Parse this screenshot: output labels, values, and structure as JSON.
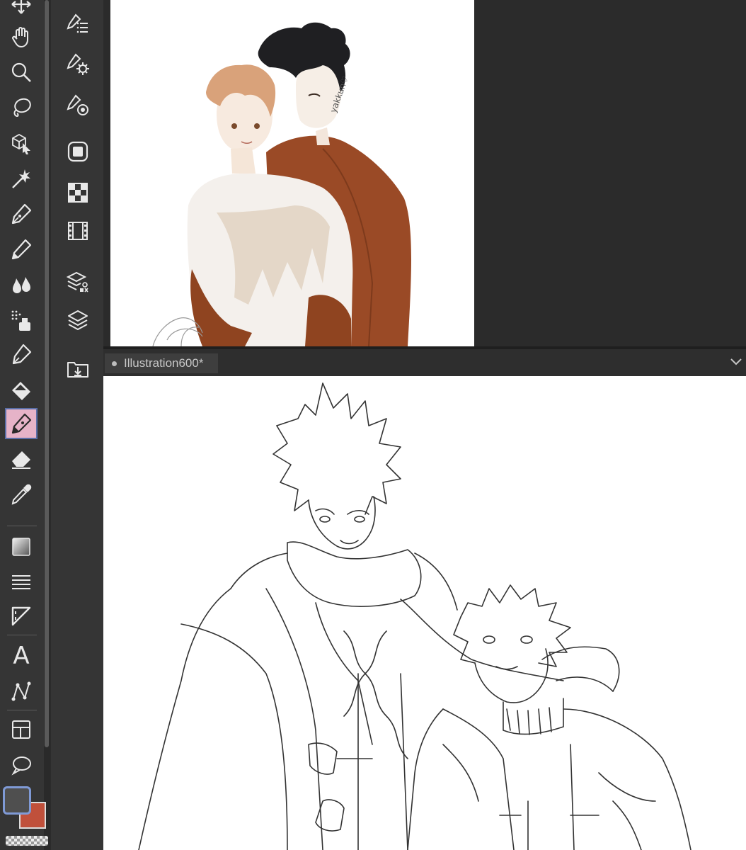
{
  "document": {
    "tab_title": "Illustration600*",
    "modified": true
  },
  "reference": {
    "signature": "yakkun♡"
  },
  "toolbar": {
    "tools": [
      {
        "name": "move",
        "icon": "move-arrows-icon"
      },
      {
        "name": "hand",
        "icon": "hand-icon"
      },
      {
        "name": "zoom",
        "icon": "magnifier-icon"
      },
      {
        "name": "lasso",
        "icon": "lasso-icon"
      },
      {
        "name": "object-select",
        "icon": "cube-cursor-icon"
      },
      {
        "name": "auto-select",
        "icon": "magic-wand-icon"
      },
      {
        "name": "pen",
        "icon": "pen-nib-icon"
      },
      {
        "name": "pencil",
        "icon": "pencil-icon"
      },
      {
        "name": "brush",
        "icon": "brush-drops-icon"
      },
      {
        "name": "airbrush",
        "icon": "airbrush-icon"
      },
      {
        "name": "decoration",
        "icon": "decoration-pen-icon"
      },
      {
        "name": "fill",
        "icon": "paint-bucket-icon"
      },
      {
        "name": "vector-pen",
        "icon": "vector-pen-icon",
        "active": true
      },
      {
        "name": "eraser",
        "icon": "eraser-icon"
      },
      {
        "name": "eyedropper",
        "icon": "eyedropper-icon"
      },
      {
        "name": "gradient",
        "icon": "gradient-icon"
      },
      {
        "name": "lines",
        "icon": "parallel-lines-icon"
      },
      {
        "name": "ruler",
        "icon": "ruler-icon"
      },
      {
        "name": "text",
        "icon": "text-tool-icon",
        "glyph": "A"
      },
      {
        "name": "curve",
        "icon": "curve-icon"
      },
      {
        "name": "frame",
        "icon": "frame-border-icon"
      },
      {
        "name": "balloon",
        "icon": "speech-balloon-icon"
      }
    ],
    "main_color": "#4f4f4f",
    "sub_color": "#c0503b",
    "accent_active": "#e6b3c8",
    "accent_border": "#7f9ad6"
  },
  "panel_column": {
    "icons": [
      "sub-tool-list-icon",
      "tool-settings-icon",
      "brush-size-icon",
      "navigator-icon",
      "color-set-icon",
      "animation-timeline-icon",
      "layer-property-icon",
      "layer-icon",
      "import-download-icon"
    ]
  }
}
